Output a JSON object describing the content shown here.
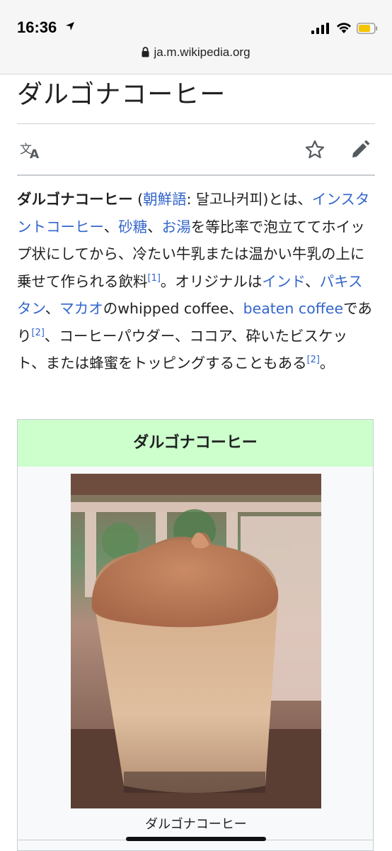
{
  "status": {
    "time": "16:36"
  },
  "browser": {
    "url": "ja.m.wikipedia.org"
  },
  "page": {
    "title": "ダルゴナコーヒー",
    "lang_icon_label": "文A"
  },
  "article": {
    "p1": "ダルゴナコーヒー",
    "p2": " (",
    "p3": "朝鮮語",
    "p4": ": 달고나커피)とは、",
    "p5": "インスタントコーヒー",
    "p6": "、",
    "p7": "砂糖",
    "p8": "、",
    "p9": "お湯",
    "p10": "を等比率で泡立ててホイップ状にしてから、冷たい牛乳または温かい牛乳の上に乗せて作られる飲料",
    "p11": "[1]",
    "p12": "。オリジナルは",
    "p13": "インド",
    "p14": "、",
    "p15": "パキスタン",
    "p16": "、",
    "p17": "マカオ",
    "p18": "のwhipped coffee、",
    "p19": "beaten coffee",
    "p20": "であり",
    "p21": "[2]",
    "p22": "、コーヒーパウダー、ココア、砕いたビスケット、または蜂蜜をトッピングすることもある",
    "p23": "[2]",
    "p24": "。"
  },
  "infobox": {
    "heading": "ダルゴナコーヒー",
    "caption": "ダルゴナコーヒー"
  }
}
